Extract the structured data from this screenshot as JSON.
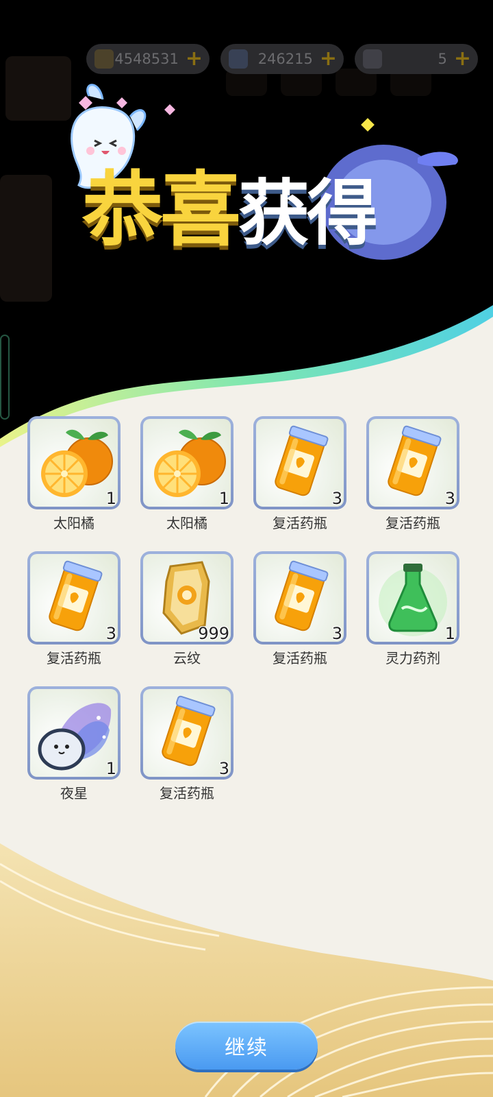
{
  "currency": [
    {
      "icon": "gold-ingot-icon",
      "value": "4548531"
    },
    {
      "icon": "diamond-icon",
      "value": "246215"
    },
    {
      "icon": "ticket-icon",
      "value": "5"
    }
  ],
  "title": {
    "part1": "恭喜",
    "part2": "获得"
  },
  "items": [
    {
      "name": "太阳橘",
      "count": "1",
      "icon": "orange-icon"
    },
    {
      "name": "太阳橘",
      "count": "1",
      "icon": "orange-icon"
    },
    {
      "name": "复活药瓶",
      "count": "3",
      "icon": "revive-bottle-icon"
    },
    {
      "name": "复活药瓶",
      "count": "3",
      "icon": "revive-bottle-icon"
    },
    {
      "name": "复活药瓶",
      "count": "3",
      "icon": "revive-bottle-icon"
    },
    {
      "name": "云纹",
      "count": "999",
      "icon": "cloud-crystal-icon"
    },
    {
      "name": "复活药瓶",
      "count": "3",
      "icon": "revive-bottle-icon"
    },
    {
      "name": "灵力药剂",
      "count": "1",
      "icon": "spirit-potion-icon"
    },
    {
      "name": "夜星",
      "count": "1",
      "icon": "night-star-pet-icon"
    },
    {
      "name": "复活药瓶",
      "count": "3",
      "icon": "revive-bottle-icon"
    }
  ],
  "continue_label": "继续",
  "colors": {
    "title_yellow": "#f9d43e",
    "button_blue": "#4a9af1",
    "panel_cream": "#f3f1ea"
  }
}
